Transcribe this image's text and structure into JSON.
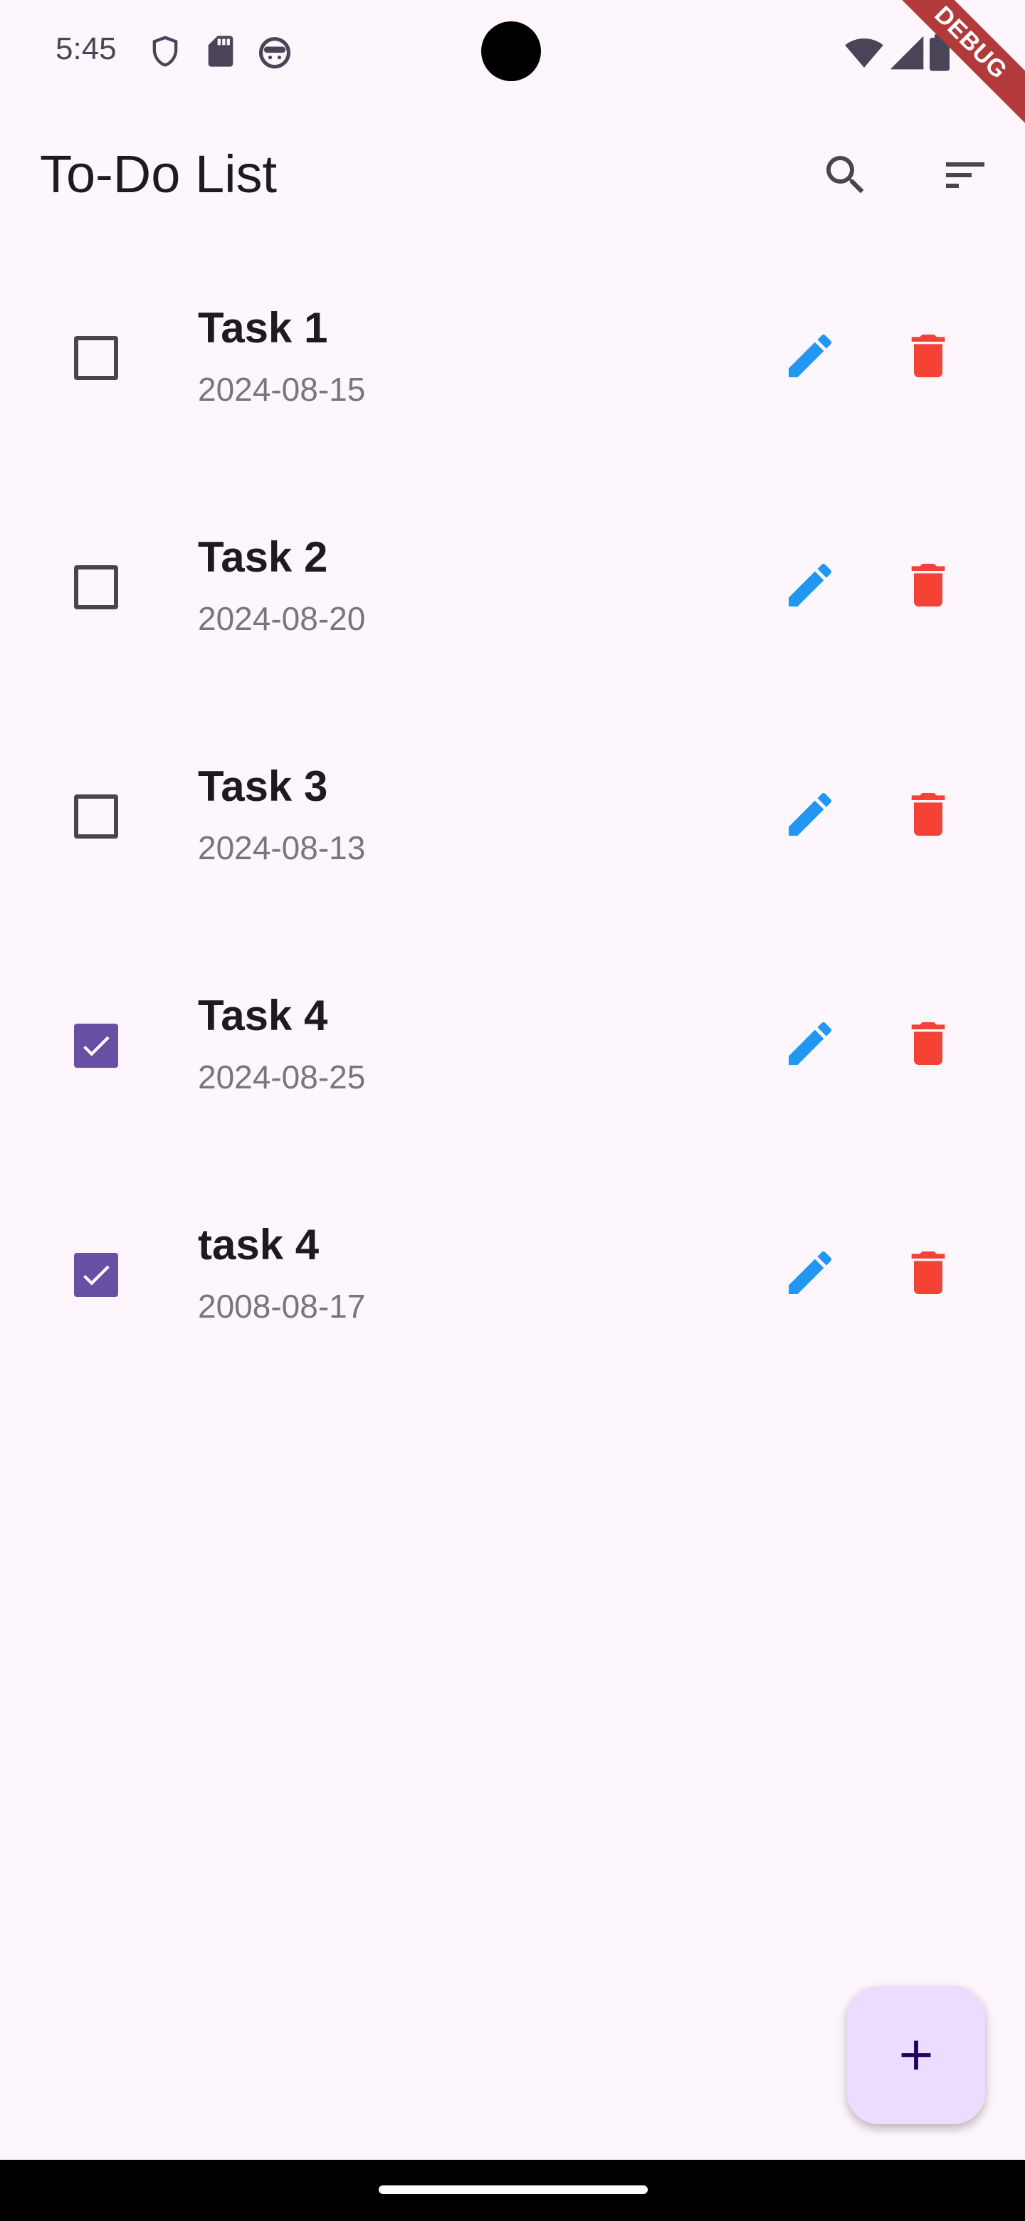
{
  "status_bar": {
    "time": "5:45",
    "icons": [
      "shield-icon",
      "sd-card-icon",
      "android-face-icon",
      "wifi-icon",
      "signal-icon",
      "battery-icon"
    ]
  },
  "debug_banner": {
    "label": "DEBUG"
  },
  "app_bar": {
    "title": "To-Do List",
    "actions": [
      "search-icon",
      "sort-icon"
    ]
  },
  "tasks": [
    {
      "title": "Task 1",
      "date": "2024-08-15",
      "done": false
    },
    {
      "title": "Task 2",
      "date": "2024-08-20",
      "done": false
    },
    {
      "title": "Task 3",
      "date": "2024-08-13",
      "done": false
    },
    {
      "title": "Task 4",
      "date": "2024-08-25",
      "done": true
    },
    {
      "title": "task 4",
      "date": "2008-08-17",
      "done": true
    }
  ],
  "fab": {
    "icon": "plus-icon"
  },
  "colors": {
    "background": "#fdf7fd",
    "accent": "#6750a4",
    "edit": "#2196f3",
    "delete": "#f44336",
    "fab_bg": "#ebddff",
    "fab_icon": "#21005d"
  }
}
